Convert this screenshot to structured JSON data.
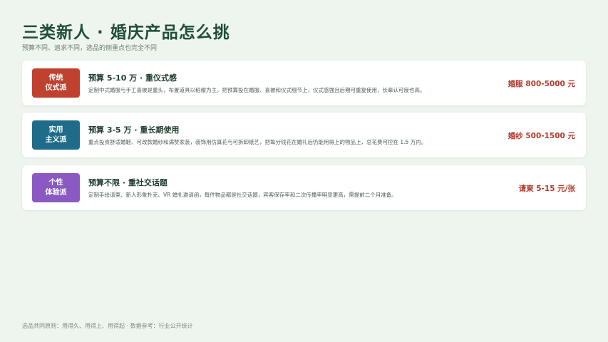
{
  "header": {
    "title": "三类新人 · 婚庆产品怎么挑",
    "subtitle": "预算不同、追求不同，选品的侧重点也完全不同"
  },
  "cards": [
    {
      "badge_line1": "传统",
      "badge_line2": "仪式派",
      "badge_color": "#c0412e",
      "title": "预算 5-10 万 · 重仪式感",
      "desc": "定制中式婚服与手工喜被是重头，布置道具以稻缨为主，把预算投在婚服、喜被和仪式细节上，仪式感强且后期可重复使用，长辈认可度也高。",
      "price": "婚服 800-5000 元"
    },
    {
      "badge_line1": "实用",
      "badge_line2": "主义派",
      "badge_color": "#1e6b8a",
      "title": "预算 3-5 万 · 重长期使用",
      "desc": "重点投资舒适婚鞋、可改款婚纱和满赞家装，装饰用仿真花与可拆卸纸艺，把每分钱花在婚礼后仍能用得上的物品上，总花费可控在 1.5 万内。",
      "price": "婚纱 500-1500 元"
    },
    {
      "badge_line1": "个性",
      "badge_line2": "体验派",
      "badge_color": "#8a5ac2",
      "title": "预算不限 · 重社交话题",
      "desc": "定制手绘请柬、新人形象扑克、VR 婚礼邀请函，每件物品都是社交话题，宾客保存率和二次传播率明显更高，需提前二个月准备。",
      "price": "请柬 5-15 元/张"
    }
  ],
  "footer": {
    "text": "选品共同原则：用得久、用得上、用得起 · 数据参考：行业公开统计"
  }
}
